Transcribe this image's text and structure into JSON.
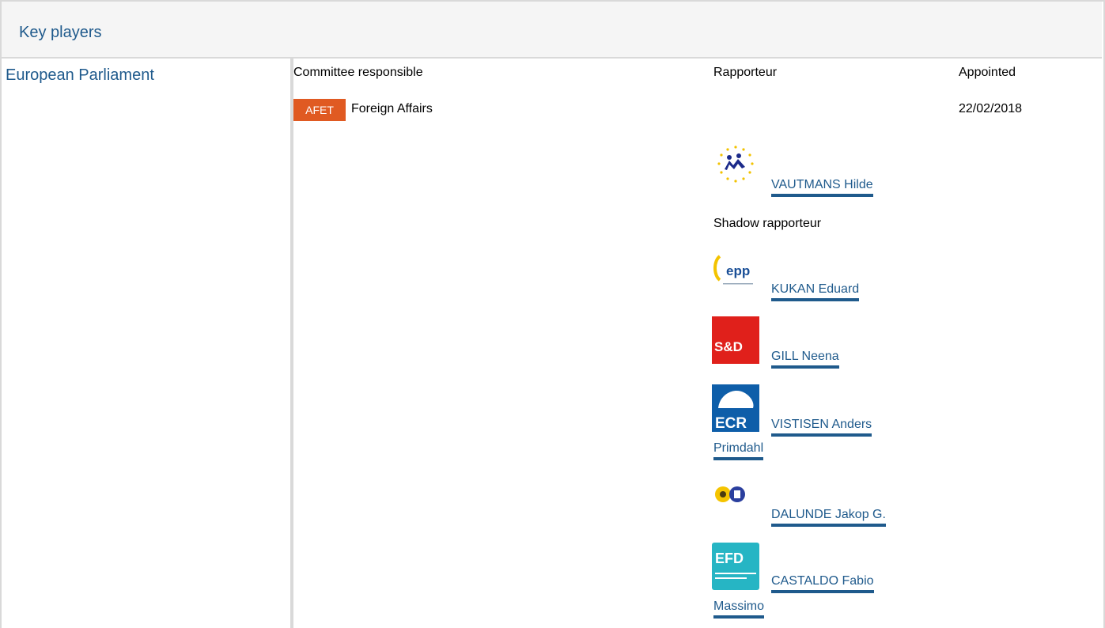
{
  "header": {
    "title": "Key players"
  },
  "institution": "European Parliament",
  "table": {
    "col_committee": "Committee responsible",
    "col_rapporteur": "Rapporteur",
    "col_appointed": "Appointed"
  },
  "committee": {
    "abbr": "AFET",
    "name": "Foreign Affairs",
    "appointed": "22/02/2018"
  },
  "rapporteur": {
    "name": "VAUTMANS Hilde",
    "group_logo": "renew-stars-logo"
  },
  "shadow_label": "Shadow rapporteur",
  "shadow_rapporteurs": [
    {
      "name": "KUKAN Eduard",
      "logo_text": "epp"
    },
    {
      "name": "GILL Neena",
      "logo_text": "S&D"
    },
    {
      "name": "VISTISEN Anders Primdahl",
      "line1": "VISTISEN Anders",
      "line2": "Primdahl",
      "logo_text": "ECR"
    },
    {
      "name": "DALUNDE Jakop G.",
      "logo_text": "greens-efa-logo"
    },
    {
      "name": "CASTALDO Fabio Massimo",
      "line1": "CASTALDO Fabio",
      "line2": "Massimo",
      "logo_text": "EFD"
    }
  ],
  "colors": {
    "accent": "#1f5a8c",
    "badge": "#e05a22",
    "border": "#d9d9d9"
  }
}
